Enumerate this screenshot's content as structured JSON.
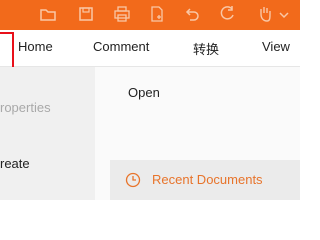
{
  "toolbar": {
    "icons": [
      "folder-icon",
      "save-icon",
      "print-icon",
      "new-document-icon",
      "undo-icon",
      "redo-icon",
      "hand-tool-icon",
      "dropdown-arrow-icon"
    ],
    "background": "#f26a1b"
  },
  "menu": {
    "items": [
      "Home",
      "Comment",
      "转换",
      "View"
    ]
  },
  "left_panel": {
    "items": [
      "roperties",
      "reate"
    ]
  },
  "main": {
    "open_label": "Open",
    "recent_label": "Recent Documents",
    "accent": "#e8742b"
  }
}
